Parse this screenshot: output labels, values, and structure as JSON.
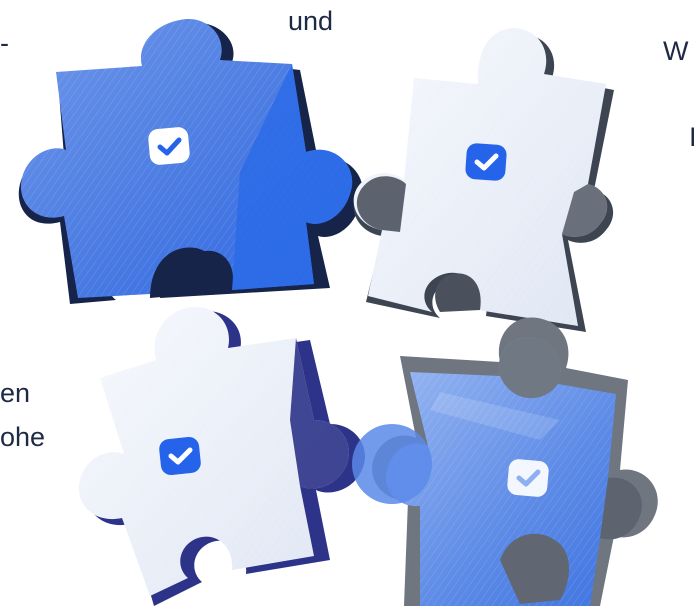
{
  "text_fragments": {
    "top_left": "und",
    "top_left_dash": "-",
    "top_right": "W",
    "mid_right": "I",
    "bottom_left_1": "en",
    "bottom_left_2": "ohe"
  },
  "puzzle_pieces": [
    {
      "name": "top-left",
      "tone": "blue",
      "checked": true
    },
    {
      "name": "top-right",
      "tone": "light",
      "checked": true
    },
    {
      "name": "bottom-left",
      "tone": "light-navy",
      "checked": true
    },
    {
      "name": "bottom-right",
      "tone": "blue-grey",
      "checked": true
    }
  ],
  "colors": {
    "blue": "#3a6fe0",
    "blue_light": "#8db0f0",
    "navy": "#16244a",
    "indigo": "#2c3388",
    "light": "#e8edf7",
    "grey": "#6f7680",
    "check_badge": "#2563eb"
  }
}
